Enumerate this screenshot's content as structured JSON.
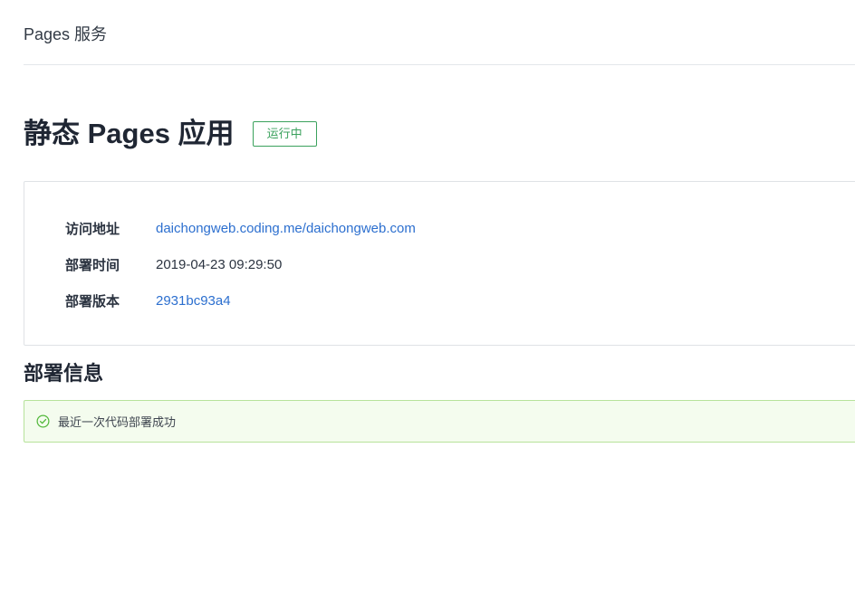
{
  "breadcrumb": {
    "text": "Pages 服务"
  },
  "header": {
    "title": "静态 Pages 应用",
    "status": "运行中",
    "status_color": "#3aa15c"
  },
  "info": {
    "items": [
      {
        "label": "访问地址",
        "value": "daichongweb.coding.me/daichongweb.com"
      },
      {
        "label": "部署时间",
        "value": "2019-04-23 09:29:50"
      },
      {
        "label": "部署版本",
        "value": "2931bc93a4"
      }
    ],
    "link_color": "#2c6fcf"
  },
  "deploy": {
    "section_title": "部署信息",
    "alert_icon": "check-circle-icon",
    "alert_text": "最近一次代码部署成功",
    "alert_color": "#52b83a"
  }
}
